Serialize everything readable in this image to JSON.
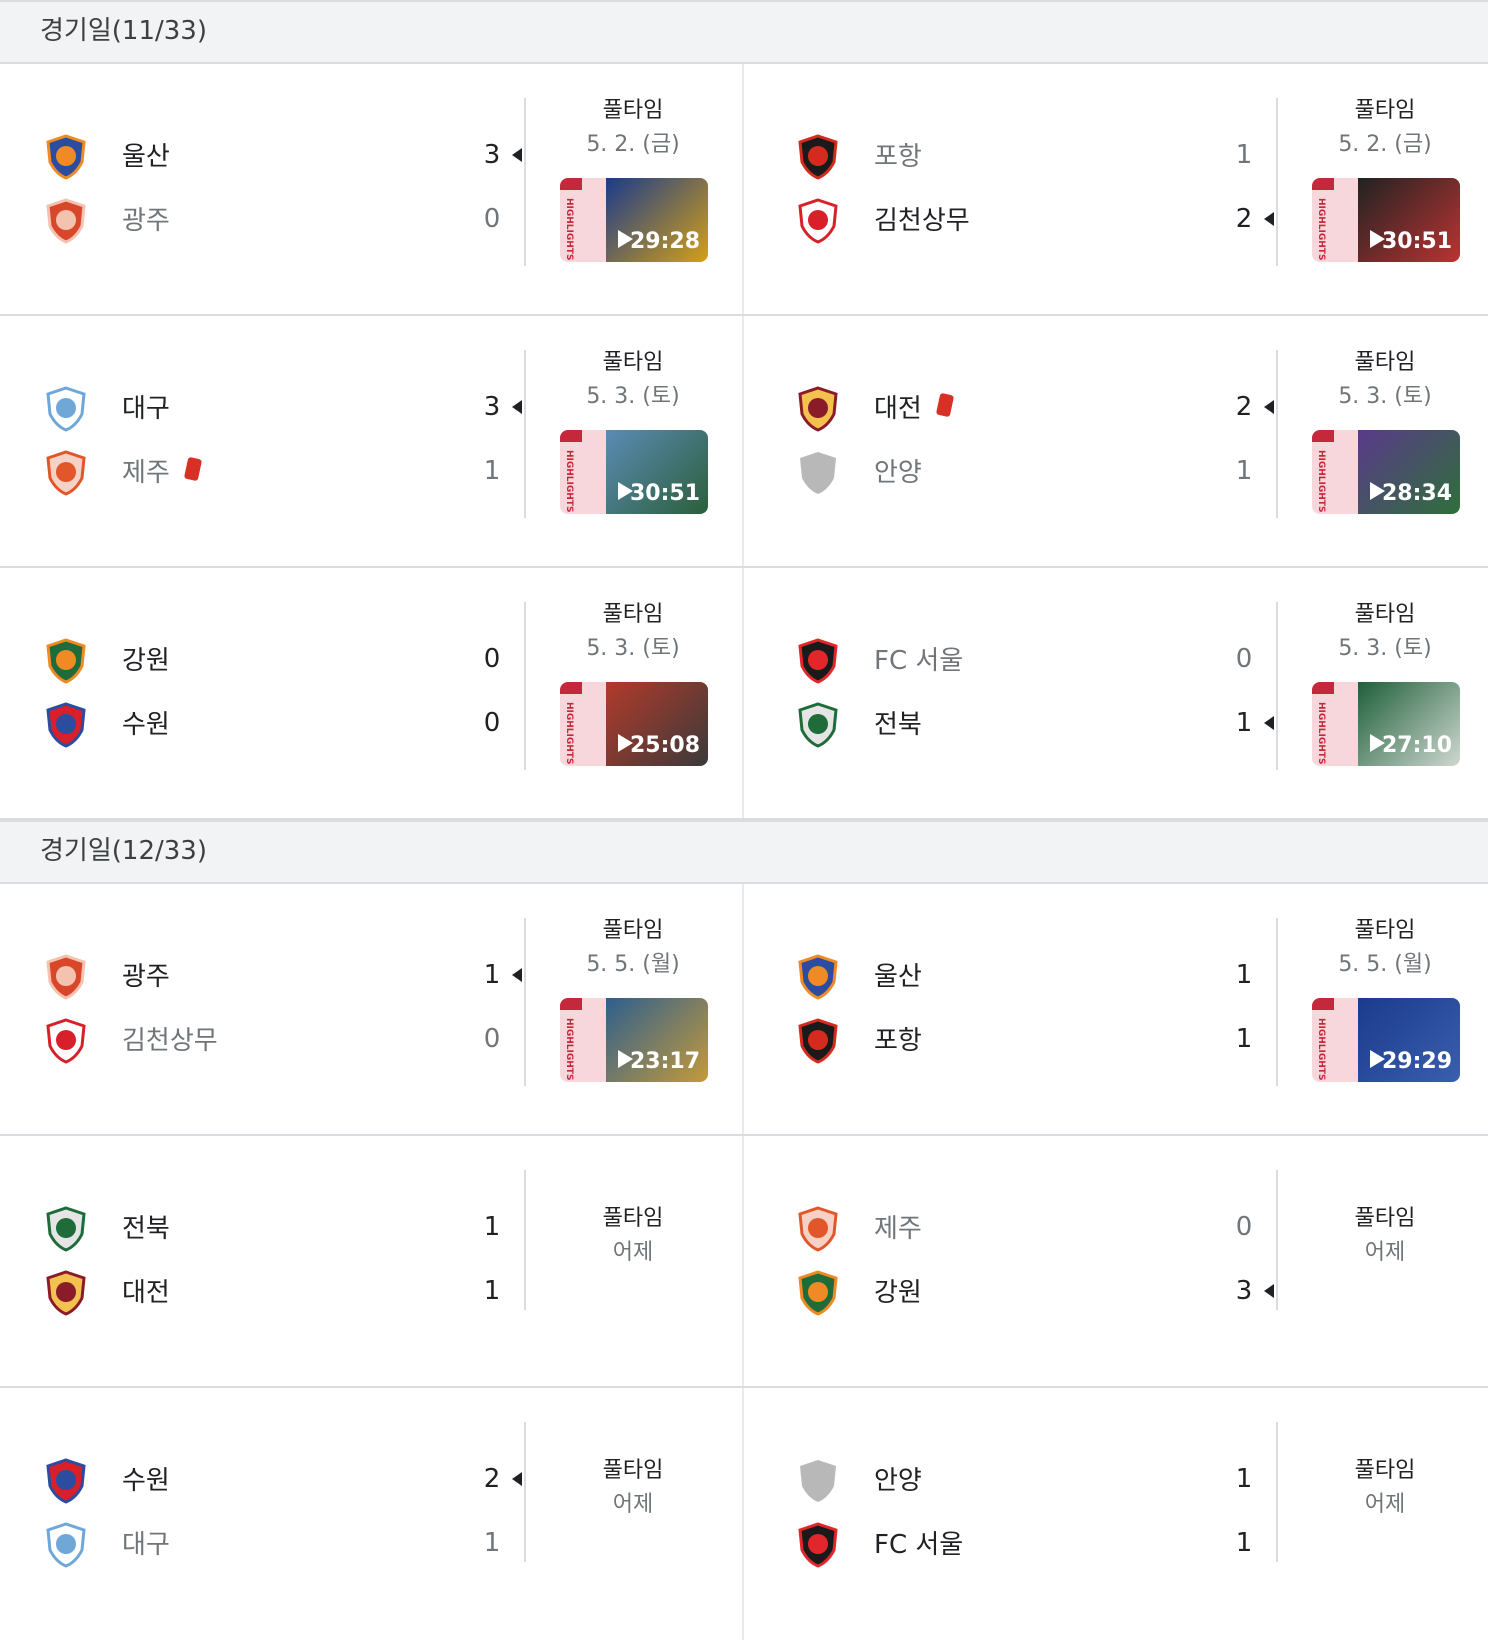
{
  "rounds": [
    {
      "title": "경기일(11/33)",
      "matches": [
        {
          "home": {
            "name": "울산",
            "score": "3",
            "logo": "ulsan-logo",
            "win": true
          },
          "away": {
            "name": "광주",
            "score": "0",
            "logo": "gwangju-logo",
            "win": false
          },
          "status": "풀타임",
          "date": "5. 2. (금)",
          "video": "29:28",
          "colors": [
            "#1b3a8c",
            "#d4a017"
          ]
        },
        {
          "home": {
            "name": "포항",
            "score": "1",
            "logo": "pohang-logo",
            "win": false
          },
          "away": {
            "name": "김천상무",
            "score": "2",
            "logo": "gimcheon-logo",
            "win": true
          },
          "status": "풀타임",
          "date": "5. 2. (금)",
          "video": "30:51",
          "colors": [
            "#222",
            "#b33"
          ]
        },
        {
          "home": {
            "name": "대구",
            "score": "3",
            "logo": "daegu-logo",
            "win": true
          },
          "away": {
            "name": "제주",
            "score": "1",
            "logo": "jeju-logo",
            "win": false,
            "red": true
          },
          "status": "풀타임",
          "date": "5. 3. (토)",
          "video": "30:51",
          "colors": [
            "#5b8bb5",
            "#2b5f3a"
          ]
        },
        {
          "home": {
            "name": "대전",
            "score": "2",
            "logo": "daejeon-logo",
            "win": true,
            "red": true
          },
          "away": {
            "name": "안양",
            "score": "1",
            "logo": "anyang-logo",
            "win": false
          },
          "status": "풀타임",
          "date": "5. 3. (토)",
          "video": "28:34",
          "colors": [
            "#5a3a8a",
            "#2f6f3a"
          ]
        },
        {
          "home": {
            "name": "강원",
            "score": "0",
            "logo": "gangwon-logo",
            "win": false
          },
          "away": {
            "name": "수원",
            "score": "0",
            "logo": "suwon-logo",
            "win": false
          },
          "status": "풀타임",
          "date": "5. 3. (토)",
          "video": "25:08",
          "colors": [
            "#b23a2a",
            "#3a3a3a"
          ]
        },
        {
          "home": {
            "name": "FC 서울",
            "score": "0",
            "logo": "seoul-logo",
            "win": false
          },
          "away": {
            "name": "전북",
            "score": "1",
            "logo": "jeonbuk-logo",
            "win": true
          },
          "status": "풀타임",
          "date": "5. 3. (토)",
          "video": "27:10",
          "colors": [
            "#1f5f3a",
            "#cfd8d0"
          ]
        }
      ]
    },
    {
      "title": "경기일(12/33)",
      "matches": [
        {
          "home": {
            "name": "광주",
            "score": "1",
            "logo": "gwangju-logo",
            "win": true
          },
          "away": {
            "name": "김천상무",
            "score": "0",
            "logo": "gimcheon-logo",
            "win": false
          },
          "status": "풀타임",
          "date": "5. 5. (월)",
          "video": "23:17",
          "colors": [
            "#2e5e8e",
            "#c49a3a"
          ]
        },
        {
          "home": {
            "name": "울산",
            "score": "1",
            "logo": "ulsan-logo",
            "win": false
          },
          "away": {
            "name": "포항",
            "score": "1",
            "logo": "pohang-logo",
            "win": false
          },
          "status": "풀타임",
          "date": "5. 5. (월)",
          "video": "29:29",
          "colors": [
            "#1b3a8c",
            "#3a5fae"
          ]
        },
        {
          "home": {
            "name": "전북",
            "score": "1",
            "logo": "jeonbuk-logo",
            "win": false
          },
          "away": {
            "name": "대전",
            "score": "1",
            "logo": "daejeon-logo",
            "win": false
          },
          "status": "풀타임",
          "date": "어제"
        },
        {
          "home": {
            "name": "제주",
            "score": "0",
            "logo": "jeju-logo",
            "win": false
          },
          "away": {
            "name": "강원",
            "score": "3",
            "logo": "gangwon-logo",
            "win": true
          },
          "status": "풀타임",
          "date": "어제"
        },
        {
          "home": {
            "name": "수원",
            "score": "2",
            "logo": "suwon-logo",
            "win": true
          },
          "away": {
            "name": "대구",
            "score": "1",
            "logo": "daegu-logo",
            "win": false
          },
          "status": "풀타임",
          "date": "어제"
        },
        {
          "home": {
            "name": "안양",
            "score": "1",
            "logo": "anyang-logo",
            "win": false
          },
          "away": {
            "name": "FC 서울",
            "score": "1",
            "logo": "seoul-logo",
            "win": false
          },
          "status": "풀타임",
          "date": "어제"
        }
      ]
    }
  ],
  "video_badge": "HIGHLIGHTS"
}
